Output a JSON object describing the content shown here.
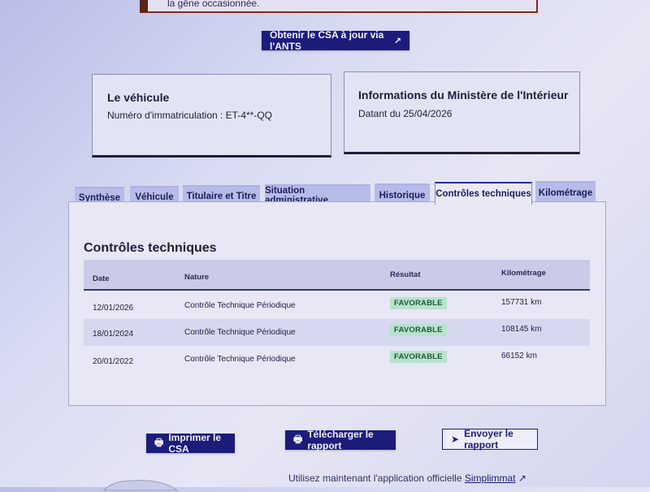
{
  "notice": {
    "text": "la gêne occasionnée."
  },
  "csa_button": {
    "label": "Obtenir le CSA à jour via l'ANTS",
    "icon": "external-link-icon"
  },
  "vehicle_card": {
    "title": "Le véhicule",
    "plate_label": "Numéro d'immatriculation : ET-4**-QQ"
  },
  "ministry_card": {
    "title": "Informations du Ministère de l'Intérieur",
    "date_text": "Datant du 25/04/2026"
  },
  "tabs": [
    {
      "label": "Synthèse"
    },
    {
      "label": "Véhicule"
    },
    {
      "label": "Titulaire et Titre"
    },
    {
      "label": "Situation administrative"
    },
    {
      "label": "Historique"
    },
    {
      "label": "Contrôles techniques",
      "active": true
    },
    {
      "label": "Kilométrage"
    }
  ],
  "panel": {
    "title": "Contrôles techniques",
    "columns": [
      "Date",
      "Nature",
      "Résultat",
      "Kilométrage"
    ],
    "rows": [
      {
        "date": "12/01/2026",
        "nature": "Contrôle Technique Périodique",
        "result": "FAVORABLE",
        "km": "157731 km"
      },
      {
        "date": "18/01/2024",
        "nature": "Contrôle Technique Périodique",
        "result": "FAVORABLE",
        "km": "108145 km"
      },
      {
        "date": "20/01/2022",
        "nature": "Contrôle Technique Périodique",
        "result": "FAVORABLE",
        "km": "66152 km"
      }
    ]
  },
  "actions": {
    "print_label": "Imprimer le CSA",
    "download_label": "Télécharger le rapport",
    "send_label": "Envoyer le rapport"
  },
  "footer": {
    "prefix": "Utilisez maintenant l'application officielle",
    "link": "Simplimmat"
  },
  "colors": {
    "primary": "#1c1c7a",
    "tab_bg": "#b7bbe9",
    "badge_bg": "#b8e2cc",
    "badge_text": "#1d5a3a"
  }
}
